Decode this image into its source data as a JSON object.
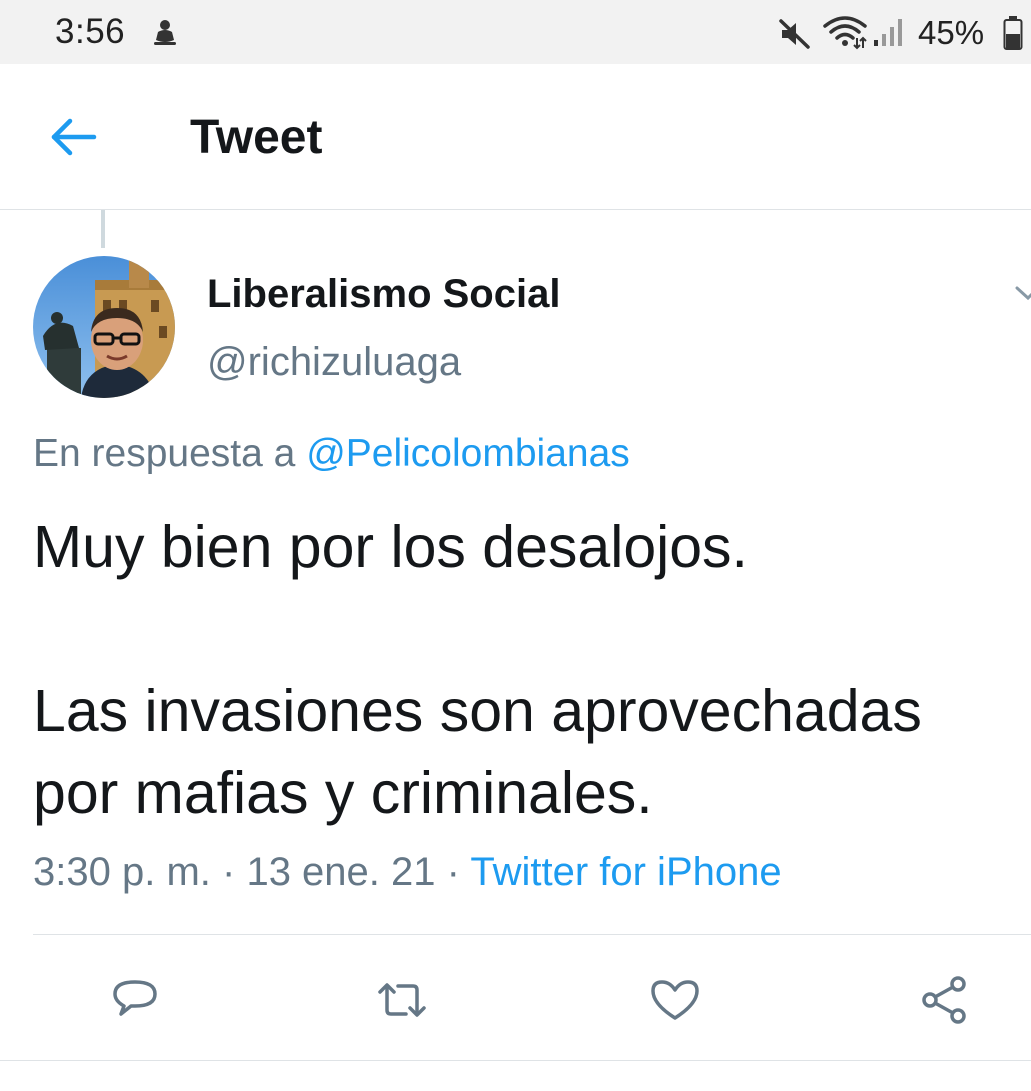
{
  "status_bar": {
    "time": "3:56",
    "battery_percent": "45%",
    "icons": [
      "notification-icon",
      "mute-icon",
      "wifi-icon",
      "signal-icon",
      "battery-icon"
    ]
  },
  "header": {
    "title": "Tweet",
    "back_icon": "back-arrow-icon"
  },
  "tweet": {
    "author_name": "Liberalismo Social",
    "author_handle": "@richizuluaga",
    "reply_prefix": "En respuesta a",
    "reply_mention": "@Pelicolombianas",
    "text_line_1": "Muy bien por los desalojos.",
    "text_line_2": "Las invasiones son aprovechadas",
    "text_line_3": "por mafias y criminales.",
    "time": "3:30 p. m.",
    "date": "13 ene. 21",
    "separator": "·",
    "source": "Twitter for iPhone"
  },
  "actions": [
    "reply-icon",
    "retweet-icon",
    "like-icon",
    "share-icon"
  ],
  "colors": {
    "accent": "#1d9bf0",
    "secondary_text": "#657786",
    "primary_text": "#14171a",
    "divider": "#dfe3e6"
  }
}
